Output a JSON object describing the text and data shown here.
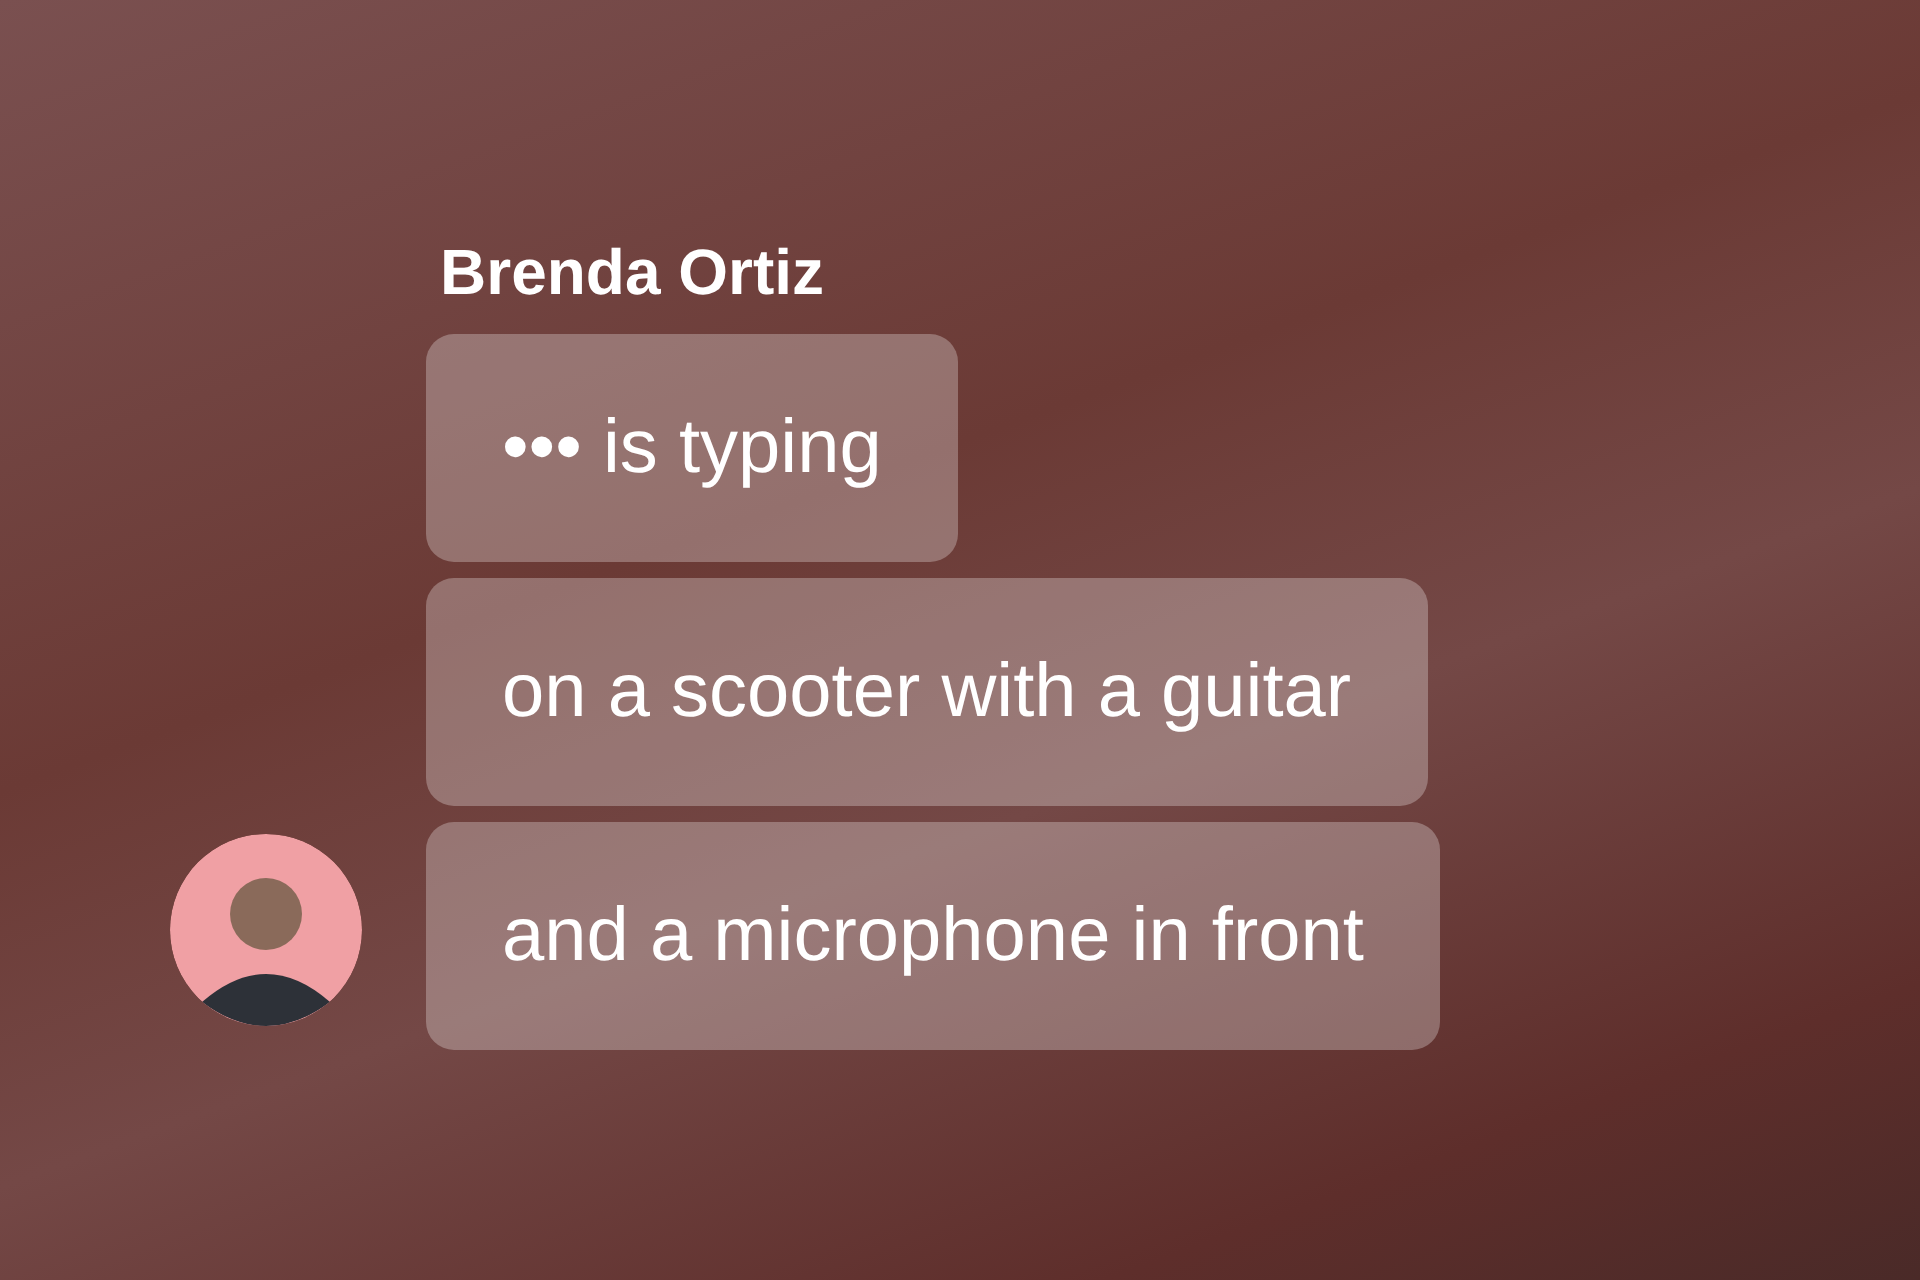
{
  "sender": {
    "name": "Brenda Ortiz"
  },
  "messages": [
    {
      "text": "••• is typing"
    },
    {
      "text": "on a scooter with a guitar"
    },
    {
      "text": "and a microphone in front"
    }
  ]
}
